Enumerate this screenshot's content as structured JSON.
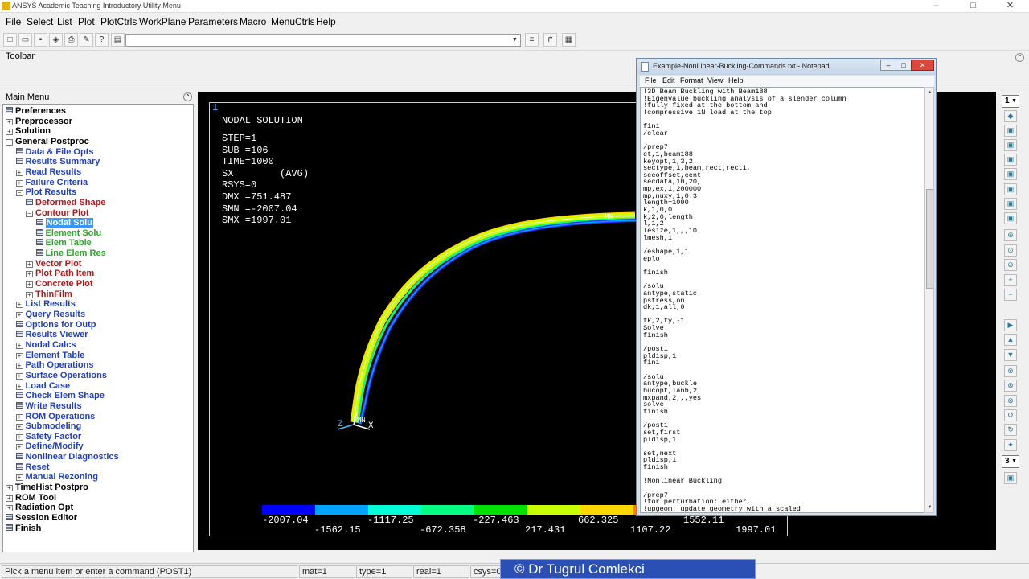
{
  "window": {
    "title": "ANSYS Academic Teaching Introductory Utility Menu",
    "minimize": "–",
    "maximize": "□",
    "close": "✕"
  },
  "menubar": [
    "File",
    "Select",
    "List",
    "Plot",
    "PlotCtrls",
    "WorkPlane",
    "Parameters",
    "Macro",
    "MenuCtrls",
    "Help"
  ],
  "toolbar_label": "Toolbar",
  "main_menu": {
    "title": "Main Menu",
    "items": [
      {
        "label": "Preferences",
        "level": 0,
        "icon": "doc",
        "color": "black"
      },
      {
        "label": "Preprocessor",
        "level": 0,
        "icon": "expand",
        "color": "black"
      },
      {
        "label": "Solution",
        "level": 0,
        "icon": "expand",
        "color": "black"
      },
      {
        "label": "General Postproc",
        "level": 0,
        "icon": "collapse",
        "color": "black"
      },
      {
        "label": "Data & File Opts",
        "level": 1,
        "icon": "doc",
        "color": "blue"
      },
      {
        "label": "Results Summary",
        "level": 1,
        "icon": "doc",
        "color": "blue"
      },
      {
        "label": "Read Results",
        "level": 1,
        "icon": "expand",
        "color": "blue"
      },
      {
        "label": "Failure Criteria",
        "level": 1,
        "icon": "expand",
        "color": "blue"
      },
      {
        "label": "Plot Results",
        "level": 1,
        "icon": "collapse",
        "color": "blue"
      },
      {
        "label": "Deformed Shape",
        "level": 2,
        "icon": "doc",
        "color": "red"
      },
      {
        "label": "Contour Plot",
        "level": 2,
        "icon": "collapse",
        "color": "red"
      },
      {
        "label": "Nodal Solu",
        "level": 3,
        "icon": "doc",
        "color": "selected"
      },
      {
        "label": "Element Solu",
        "level": 3,
        "icon": "doc",
        "color": "green"
      },
      {
        "label": "Elem Table",
        "level": 3,
        "icon": "doc",
        "color": "green"
      },
      {
        "label": "Line Elem Res",
        "level": 3,
        "icon": "doc",
        "color": "green"
      },
      {
        "label": "Vector Plot",
        "level": 2,
        "icon": "expand",
        "color": "red"
      },
      {
        "label": "Plot Path Item",
        "level": 2,
        "icon": "expand",
        "color": "red"
      },
      {
        "label": "Concrete Plot",
        "level": 2,
        "icon": "expand",
        "color": "red"
      },
      {
        "label": "ThinFilm",
        "level": 2,
        "icon": "expand",
        "color": "red"
      },
      {
        "label": "List Results",
        "level": 1,
        "icon": "expand",
        "color": "blue"
      },
      {
        "label": "Query Results",
        "level": 1,
        "icon": "expand",
        "color": "blue"
      },
      {
        "label": "Options for Outp",
        "level": 1,
        "icon": "doc",
        "color": "blue"
      },
      {
        "label": "Results Viewer",
        "level": 1,
        "icon": "doc",
        "color": "blue"
      },
      {
        "label": "Nodal Calcs",
        "level": 1,
        "icon": "expand",
        "color": "blue"
      },
      {
        "label": "Element Table",
        "level": 1,
        "icon": "expand",
        "color": "blue"
      },
      {
        "label": "Path Operations",
        "level": 1,
        "icon": "expand",
        "color": "blue"
      },
      {
        "label": "Surface Operations",
        "level": 1,
        "icon": "expand",
        "color": "blue"
      },
      {
        "label": "Load Case",
        "level": 1,
        "icon": "expand",
        "color": "blue"
      },
      {
        "label": "Check Elem Shape",
        "level": 1,
        "icon": "doc",
        "color": "blue"
      },
      {
        "label": "Write Results",
        "level": 1,
        "icon": "doc",
        "color": "blue"
      },
      {
        "label": "ROM Operations",
        "level": 1,
        "icon": "expand",
        "color": "blue"
      },
      {
        "label": "Submodeling",
        "level": 1,
        "icon": "expand",
        "color": "blue"
      },
      {
        "label": "Safety Factor",
        "level": 1,
        "icon": "expand",
        "color": "blue"
      },
      {
        "label": "Define/Modify",
        "level": 1,
        "icon": "expand",
        "color": "blue"
      },
      {
        "label": "Nonlinear Diagnostics",
        "level": 1,
        "icon": "doc",
        "color": "blue"
      },
      {
        "label": "Reset",
        "level": 1,
        "icon": "doc",
        "color": "blue"
      },
      {
        "label": "Manual Rezoning",
        "level": 1,
        "icon": "expand",
        "color": "blue"
      },
      {
        "label": "TimeHist Postpro",
        "level": 0,
        "icon": "expand",
        "color": "black"
      },
      {
        "label": "ROM Tool",
        "level": 0,
        "icon": "expand",
        "color": "black"
      },
      {
        "label": "Radiation Opt",
        "level": 0,
        "icon": "expand",
        "color": "black"
      },
      {
        "label": "Session Editor",
        "level": 0,
        "icon": "doc",
        "color": "black"
      },
      {
        "label": "Finish",
        "level": 0,
        "icon": "doc",
        "color": "black"
      }
    ]
  },
  "graphics": {
    "window_number": "1",
    "info": [
      "NODAL SOLUTION",
      "",
      "STEP=1",
      "SUB =106",
      "TIME=1000",
      "SX        (AVG)",
      "RSYS=0",
      "DMX =751.487",
      "SMN =-2007.04",
      "SMX =1997.01"
    ],
    "legend_colors": [
      "#0000ff",
      "#00a5ff",
      "#00ffd7",
      "#00ff80",
      "#00e100",
      "#c8ff00",
      "#ffd700",
      "#ff8000",
      "#ff2000"
    ],
    "legend_values_top": [
      "-2007.04",
      "-1117.25",
      "-227.463",
      "662.325",
      "1552.11"
    ],
    "legend_values_bottom": [
      "-1562.15",
      "-672.358",
      "217.431",
      "1107.22",
      "1997.01"
    ],
    "triad": {
      "z": "Z",
      "x": "X",
      "mn": "MN",
      "mx": "MX"
    }
  },
  "right_toolbar": {
    "top_select": "1",
    "bottom_select": "3"
  },
  "notepad": {
    "title": "Example-NonLinear-Buckling-Commands.txt - Notepad",
    "menu": [
      "File",
      "Edit",
      "Format",
      "View",
      "Help"
    ],
    "lines": [
      "!3D Beam Buckling with Beam188",
      "!Eigenvalue buckling analysis of a slender column",
      "!fully fixed at the bottom and",
      "!compressive 1N load at the top",
      "",
      "fini",
      "/clear",
      "",
      "/prep7",
      "et,1,beam188",
      "keyopt,1,3,2",
      "sectype,1,beam,rect,rect1,",
      "secoffset,cent",
      "secdata,10,20,",
      "mp,ex,1,200000",
      "mp,nuxy,1,0.3",
      "length=1000",
      "k,1,0,0",
      "k,2,0,length",
      "l,1,2",
      "lesize,1,,,10",
      "lmesh,1",
      "",
      "/eshape,1,1",
      "eplo",
      "",
      "finish",
      "",
      "/solu",
      "antype,static",
      "pstress,on",
      "dk,1,all,0",
      "",
      "fk,2,fy,-1",
      "Solve",
      "finish",
      "",
      "/post1",
      "pldisp,1",
      "fini",
      "",
      "/solu",
      "antype,buckle",
      "bucopt,lanb,2",
      "mxpand,2,,,yes",
      "solve",
      "finish",
      "",
      "/post1",
      "set,first",
      "pldisp,1",
      "",
      "set,next",
      "pldisp,1",
      "finish",
      "",
      "!Nonlinear Buckling",
      "",
      "/prep7",
      "!for perturbation: either,",
      "!upgeom: update geometry with a scaled"
    ]
  },
  "status": {
    "prompt": "Pick a menu item or enter a command (POST1)",
    "mat": "mat=1",
    "type": "type=1",
    "real": "real=1",
    "csys": "csys=0"
  },
  "credit": "©  Dr Tugrul Comlekci"
}
